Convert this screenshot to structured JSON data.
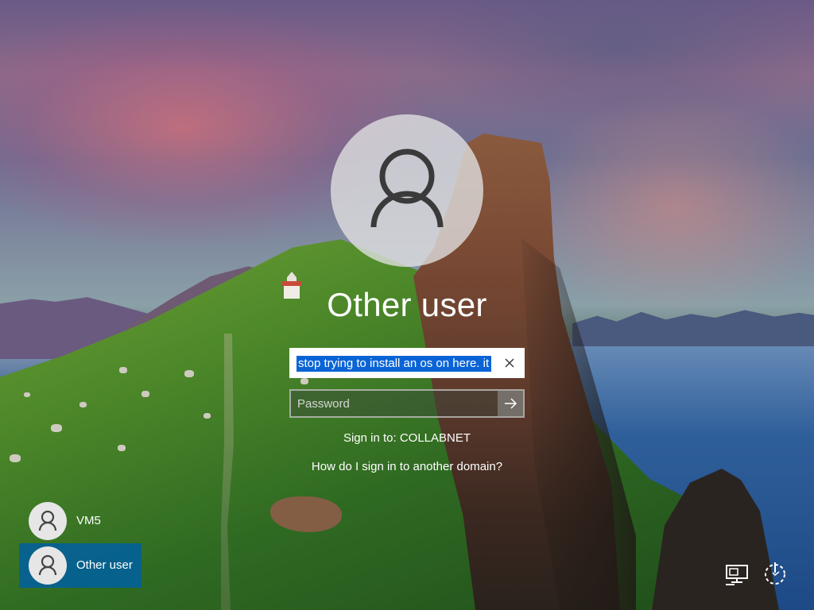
{
  "screen": {
    "type": "windows-lock-screen"
  },
  "selected_user": {
    "display_name": "Other user",
    "avatar_icon": "person-icon"
  },
  "username_field": {
    "value": "stop trying to install an os on here. it",
    "selected": true,
    "clear_icon": "close-icon"
  },
  "password_field": {
    "placeholder": "Password",
    "submit_icon": "arrow-right-icon"
  },
  "sign_in_to": "Sign in to: COLLABNET",
  "domain_link": "How do I sign in to another domain?",
  "users": [
    {
      "label": "VM5",
      "icon": "person-icon",
      "selected": false
    },
    {
      "label": "Other user",
      "icon": "person-icon",
      "selected": true
    }
  ],
  "system_icons": [
    {
      "name": "network-icon"
    },
    {
      "name": "power-icon"
    }
  ],
  "colors": {
    "selection": "#0a64d6",
    "selected_user_bg": "#005fa0",
    "text": "#ffffff"
  }
}
